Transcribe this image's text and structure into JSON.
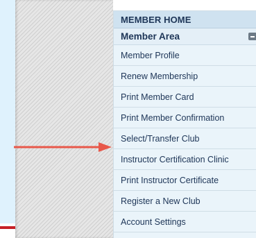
{
  "menu": {
    "header": "MEMBER HOME",
    "section": "Member Area",
    "items": [
      {
        "label": "Member Profile"
      },
      {
        "label": "Renew Membership"
      },
      {
        "label": "Print Member Card"
      },
      {
        "label": "Print Member Confirmation"
      },
      {
        "label": "Select/Transfer Club"
      },
      {
        "label": "Instructor Certification Clinic"
      },
      {
        "label": "Print Instructor Certificate"
      },
      {
        "label": "Register a New Club"
      },
      {
        "label": "Account Settings"
      }
    ]
  },
  "colors": {
    "menu_background": "#eaf4fa",
    "menu_header_background": "#cfe2f0",
    "text": "#1d3557",
    "arrow": "#e8584a",
    "left_panel_blue": "#dff2fd",
    "left_panel_red": "#c62026"
  },
  "icons": {
    "collapse": "minus-square-icon",
    "annotation": "arrow-right-icon"
  }
}
